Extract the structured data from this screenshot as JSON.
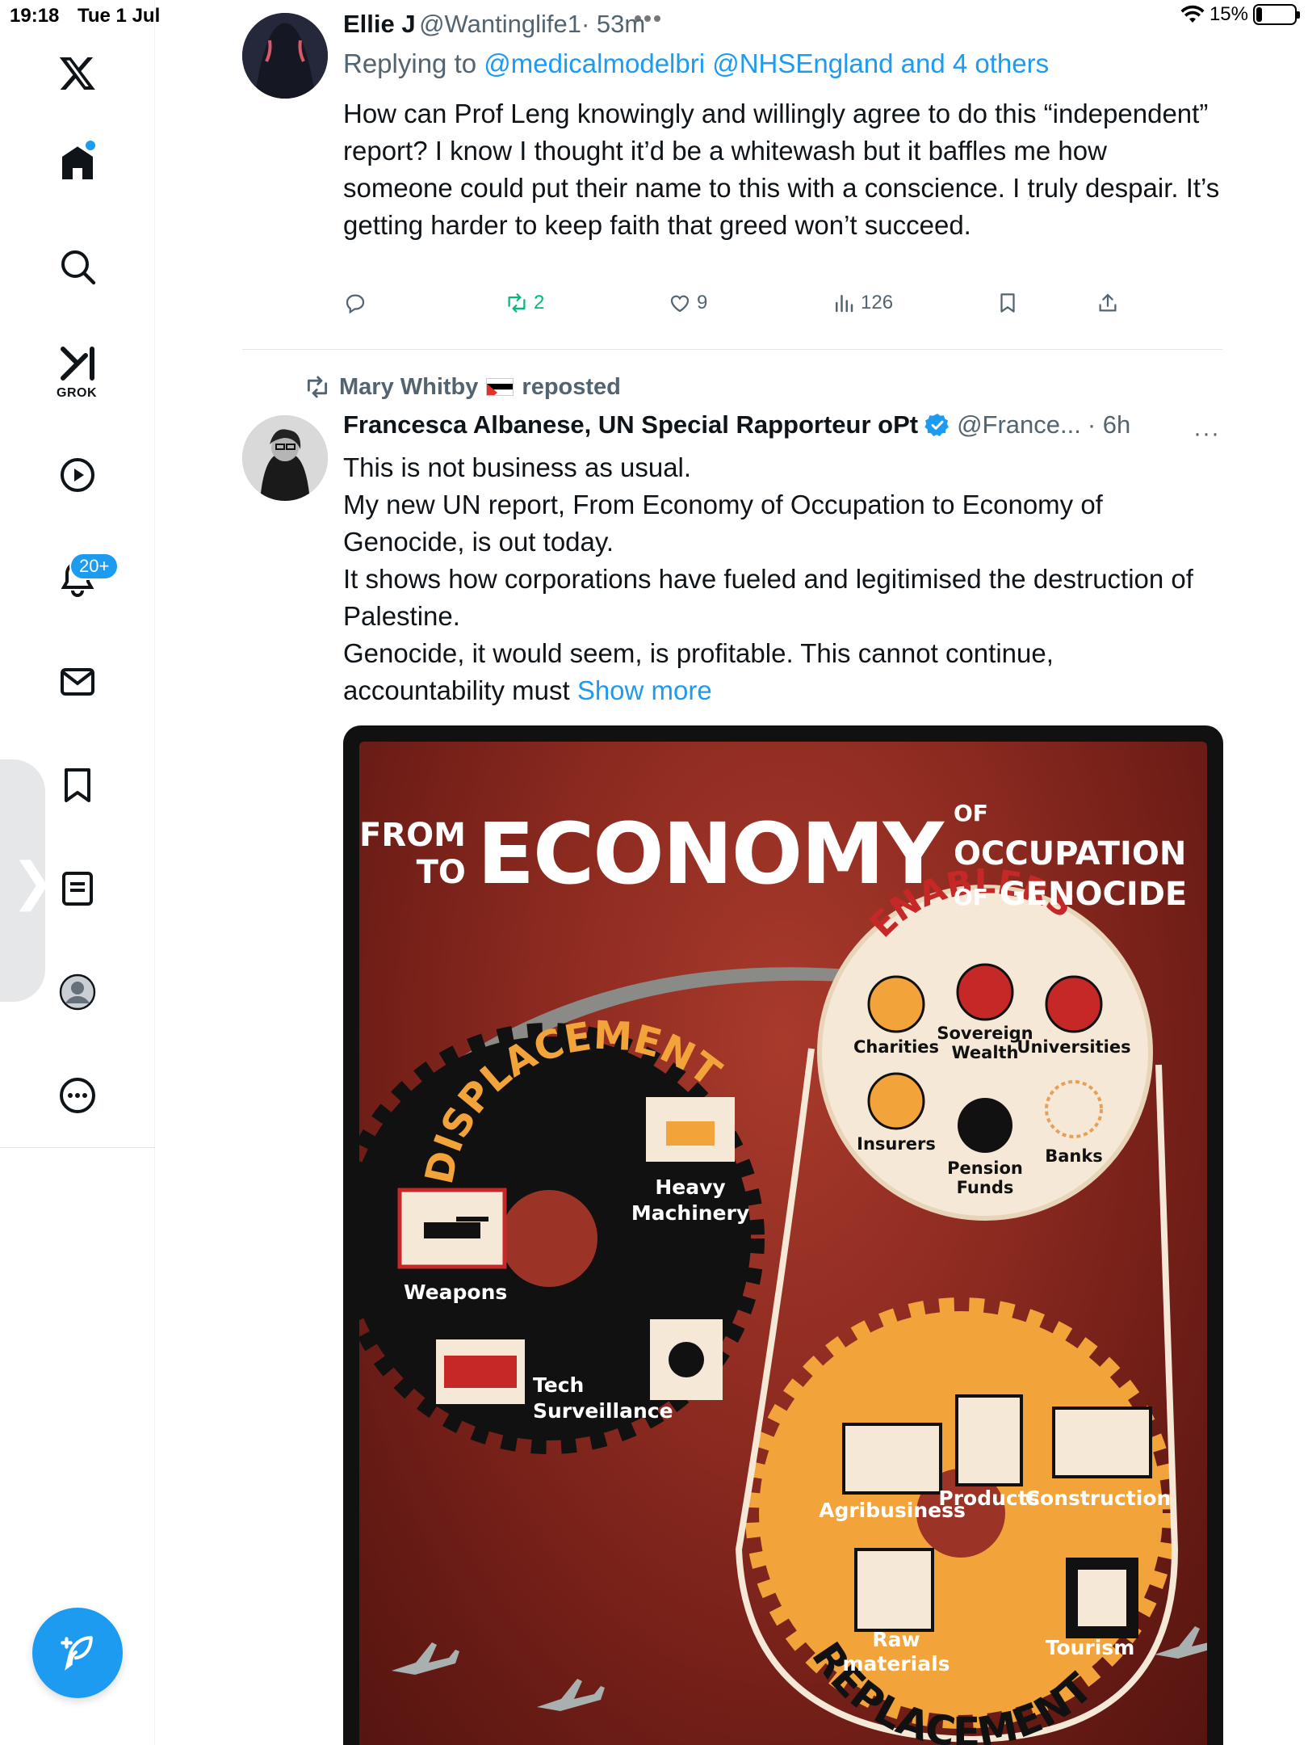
{
  "status_bar": {
    "time": "19:18",
    "date": "Tue 1 Jul",
    "battery": "15%",
    "battery_level": 0.15
  },
  "sidebar": {
    "items": [
      {
        "name": "x-logo-icon"
      },
      {
        "name": "home-icon"
      },
      {
        "name": "search-icon"
      },
      {
        "name": "grok-icon",
        "label": "GROK"
      },
      {
        "name": "video-icon"
      },
      {
        "name": "notifications-icon",
        "badge": "20+"
      },
      {
        "name": "messages-icon"
      },
      {
        "name": "bookmarks-icon"
      },
      {
        "name": "lists-icon"
      },
      {
        "name": "profile-icon"
      },
      {
        "name": "more-icon"
      }
    ]
  },
  "tweet1": {
    "name": "Ellie J",
    "handle": "@Wantinglife1",
    "time": "· 53m",
    "replying_prefix": "Replying to",
    "replying_mentions": "@medicalmodelbri @NHSEngland and 4 others",
    "body": "How can Prof Leng knowingly and willingly agree to do this “independent” report? I know I thought it’d be a whitewash but it baffles me how someone could put their name to this with a conscience. I truly despair. It’s getting harder to keep faith that greed won’t succeed.",
    "retweets": "2",
    "likes": "9",
    "views": "126"
  },
  "tweet2": {
    "reposted_by": "Mary Whitby",
    "reposted_label": "reposted",
    "name": "Francesca Albanese, UN Special Rapporteur oPt",
    "handle": "@France...",
    "time": "· 6h",
    "more": "···",
    "body_lines": [
      "This is not business as usual.",
      "My new UN report, From Economy of Occupation to Economy of Genocide, is out today.",
      "It shows how corporations have fueled and legitimised the destruction of Palestine.",
      "Genocide, it would seem, is profitable. This cannot continue,"
    ],
    "body_last": "accountability must",
    "show_more": "Show more"
  },
  "poster": {
    "from": "FROM",
    "to": "TO",
    "economy": "ECONOMY",
    "of1": "OF",
    "occupation": "OCCUPATION",
    "of2": "OF",
    "genocide": "GENOCIDE",
    "displacement": "DISPLACEMENT",
    "enablers": "ENABLERS",
    "replacement": "REPLACEMENT",
    "displacement_items": [
      "Weapons",
      "Heavy",
      "Machinery",
      "Tech",
      "Surveillance"
    ],
    "enabler_items": [
      "Charities",
      "Sovereign",
      "Wealth",
      "Universities",
      "Insurers",
      "Pension",
      "Funds",
      "Banks"
    ],
    "replacement_items": [
      "Agribusiness",
      "Products",
      "Construction",
      "Raw",
      "materials",
      "Tourism"
    ],
    "colors": {
      "background": "#8c2a20",
      "gear_dark": "#111111",
      "gear_orange": "#f2a33a",
      "cream": "#f5e8d6",
      "red_icon": "#c62828"
    }
  }
}
